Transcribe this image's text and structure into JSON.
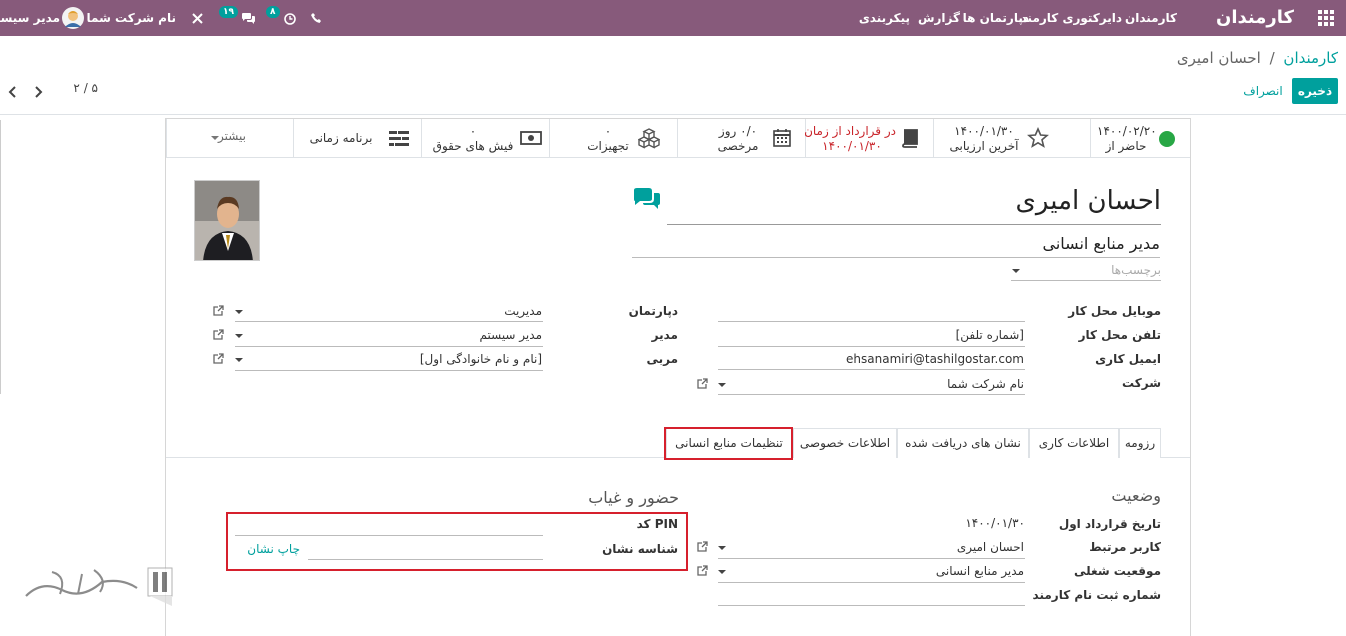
{
  "topbar": {
    "app_title": "کارمندان",
    "menu": [
      "کارمندان",
      "دایرکتوری کارمند",
      "دپارتمان ها",
      "گزارش",
      "پیکربندی"
    ],
    "user_name": "مدیر سیستم",
    "company_name": "نام شرکت شما",
    "activity_count": "۸",
    "message_count": "۱۹"
  },
  "breadcrumb": {
    "parent": "کارمندان",
    "separator": "/",
    "current": "احسان امیری"
  },
  "actions": {
    "save": "ذخیره",
    "discard": "انصراف"
  },
  "pager": {
    "text": "۵ / ۲"
  },
  "smart_buttons": [
    {
      "line1": "۱۴۰۰/۰۲/۲۰",
      "line2": "حاضر از"
    },
    {
      "line1": "۱۴۰۰/۰۱/۳۰",
      "line2": "آخرین ارزیابی"
    },
    {
      "line1": "در قرارداد از زمان",
      "line2": "۱۴۰۰/۰۱/۳۰"
    },
    {
      "line1": "۰/۰ روز",
      "line2": "مرخصی"
    },
    {
      "line1": "۰",
      "line2": "تجهیزات"
    },
    {
      "line1": "۰",
      "line2": "فیش های حقوق"
    },
    {
      "line1": "برنامه زمانی",
      "line2": ""
    },
    {
      "line1": "بیشتر",
      "line2": ""
    }
  ],
  "employee": {
    "name": "احسان امیری",
    "job_title": "مدیر منابع انسانی",
    "tags_placeholder": "برچسب‌ها"
  },
  "fields_right": [
    {
      "label": "موبایل محل کار",
      "value": ""
    },
    {
      "label": "تلفن محل کار",
      "value": "[شماره تلفن]"
    },
    {
      "label": "ایمیل کاری",
      "value": "ehsanamiri@tashilgostar.com"
    },
    {
      "label": "شرکت",
      "value": "نام شرکت شما"
    }
  ],
  "fields_left": [
    {
      "label": "دپارتمان",
      "value": "مدیریت"
    },
    {
      "label": "مدیر",
      "value": "مدیر سیستم"
    },
    {
      "label": "مربی",
      "value": "[نام و نام خانوادگی اول]"
    }
  ],
  "tabs": [
    "رزومه",
    "اطلاعات کاری",
    "نشان های دریافت شده",
    "اطلاعات خصوصی",
    "تنظیمات منابع انسانی"
  ],
  "status_section": {
    "title": "وضعیت",
    "fields": [
      {
        "label": "تاریخ قرارداد اول",
        "value": "۱۴۰۰/۰۱/۳۰"
      },
      {
        "label": "کاربر مرتبط",
        "value": "احسان امیری"
      },
      {
        "label": "موقعیت شغلی",
        "value": "مدیر منابع انسانی"
      },
      {
        "label": "شماره ثبت نام کارمند",
        "value": ""
      }
    ]
  },
  "attendance_section": {
    "title": "حضور و غیاب",
    "pin_label": "کد PIN",
    "badge_label": "شناسه نشان",
    "print_badge": "چاپ نشان"
  },
  "colors": {
    "brand": "#875a7b",
    "accent": "#00a09d",
    "highlight": "#d6202d",
    "present": "#28a745"
  }
}
